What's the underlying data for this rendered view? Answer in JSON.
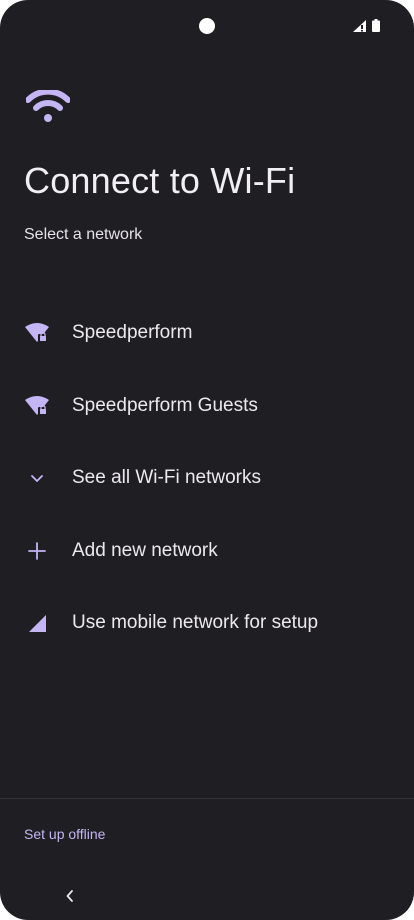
{
  "header": {
    "title": "Connect to Wi-Fi",
    "subtitle": "Select a network"
  },
  "networks": [
    {
      "label": "Speedperform",
      "icon": "wifi-lock-icon"
    },
    {
      "label": "Speedperform Guests",
      "icon": "wifi-lock-icon"
    },
    {
      "label": "See all Wi-Fi networks",
      "icon": "chevron-down-icon"
    },
    {
      "label": "Add new network",
      "icon": "plus-icon"
    },
    {
      "label": "Use mobile network for setup",
      "icon": "cellular-signal-icon"
    }
  ],
  "footer": {
    "offline_label": "Set up offline"
  },
  "colors": {
    "background": "#1f1e23",
    "accent": "#c4b5f4",
    "text": "#ece8f0"
  }
}
